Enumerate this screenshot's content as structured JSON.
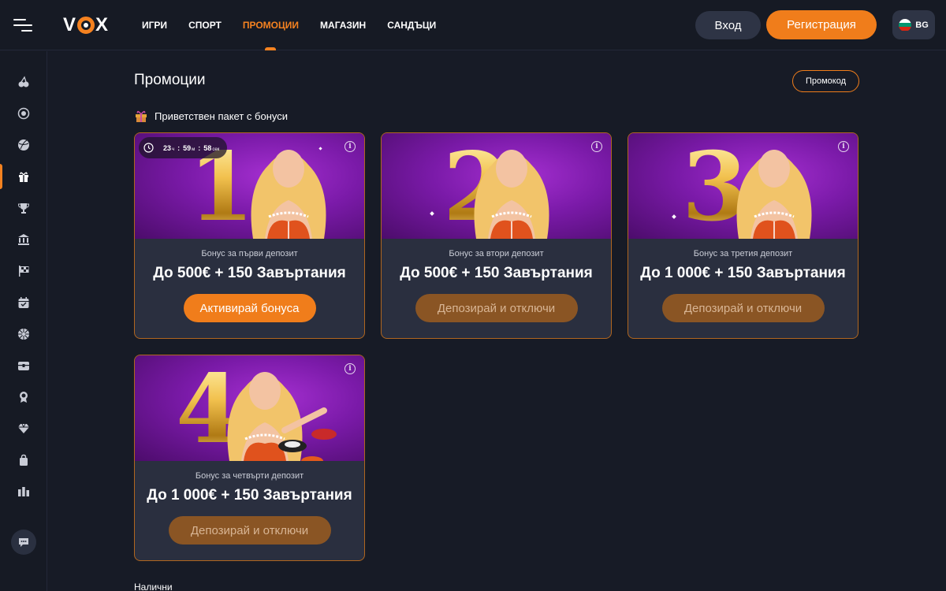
{
  "header": {
    "logo": "VOX",
    "nav": [
      "ИГРИ",
      "СПОРТ",
      "ПРОМОЦИИ",
      "МАГАЗИН",
      "САНДЪЦИ"
    ],
    "login_label": "Вход",
    "register_label": "Регистрация",
    "language": "BG"
  },
  "sidebar": {
    "items": [
      "cherry-icon",
      "target-icon",
      "ball-icon",
      "gift-icon",
      "trophy-icon",
      "bank-icon",
      "flag-icon",
      "calendar-icon",
      "wheel-icon",
      "chest-icon",
      "award-icon",
      "diamond-icon",
      "bag-icon",
      "stats-icon"
    ],
    "active": "gift-icon"
  },
  "page": {
    "title": "Промоции",
    "promo_code_label": "Промокод",
    "section_title": "Приветствен пакет с бонуси",
    "footer_label": "Налични"
  },
  "cards": [
    {
      "number": "1",
      "subtitle": "Бонус за първи депозит",
      "title": "До 500€ + 150 Завъртания",
      "button": "Активирай бонуса",
      "timer": {
        "hours": "23",
        "h_unit": "ч",
        "minutes": "59",
        "m_unit": "м",
        "seconds": "58",
        "s_unit": "сек"
      }
    },
    {
      "number": "2",
      "subtitle": "Бонус за втори депозит",
      "title": "До 500€ + 150 Завъртания",
      "button": "Депозирай и отключи"
    },
    {
      "number": "3",
      "subtitle": "Бонус за третия депозит",
      "title": "До 1 000€ + 150 Завъртания",
      "button": "Депозирай и отключи"
    },
    {
      "number": "4",
      "subtitle": "Бонус за четвърти депозит",
      "title": "До 1 000€ + 150 Завъртания",
      "button": "Депозирай и отключи"
    }
  ],
  "colors": {
    "accent": "#f07d1b",
    "background": "#171b26",
    "card": "#2a2f3f",
    "card_image": "#7a1aa8"
  }
}
